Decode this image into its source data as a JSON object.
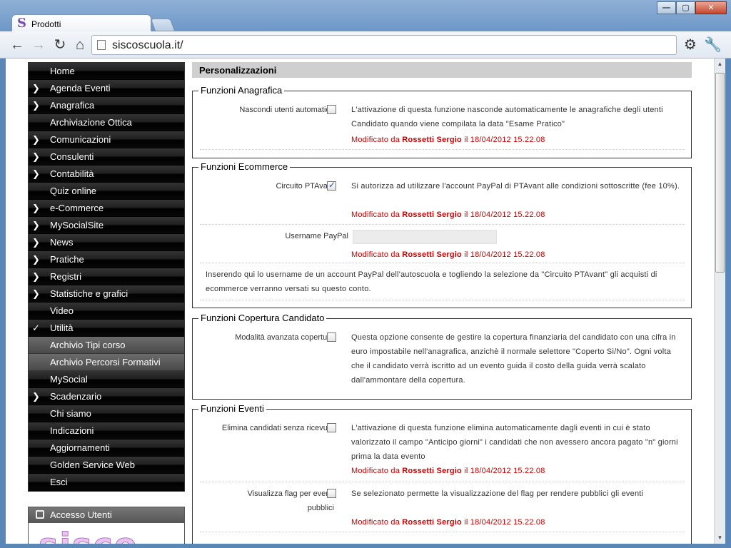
{
  "browser": {
    "tab_title": "Prodotti",
    "url": "siscoscuola.it/",
    "win_minimize": "—",
    "win_maximize": "▢",
    "win_close": "✕"
  },
  "menu": {
    "items": [
      {
        "label": "Home",
        "arrow": ""
      },
      {
        "label": "Agenda Eventi",
        "arrow": "❯"
      },
      {
        "label": "Anagrafica",
        "arrow": "❯"
      },
      {
        "label": "Archiviazione Ottica",
        "arrow": ""
      },
      {
        "label": "Comunicazioni",
        "arrow": "❯"
      },
      {
        "label": "Consulenti",
        "arrow": "❯"
      },
      {
        "label": "Contabilità",
        "arrow": "❯"
      },
      {
        "label": "Quiz online",
        "arrow": ""
      },
      {
        "label": "e-Commerce",
        "arrow": "❯"
      },
      {
        "label": "MySocialSite",
        "arrow": "❯"
      },
      {
        "label": "News",
        "arrow": "❯"
      },
      {
        "label": "Pratiche",
        "arrow": "❯"
      },
      {
        "label": "Registri",
        "arrow": "❯"
      },
      {
        "label": "Statistiche e grafici",
        "arrow": "❯"
      },
      {
        "label": "Video",
        "arrow": ""
      },
      {
        "label": "Utilità",
        "arrow": "✓"
      },
      {
        "label": "Archivio Tipi corso",
        "arrow": ""
      },
      {
        "label": "Archivio Percorsi Formativi",
        "arrow": ""
      },
      {
        "label": "MySocial",
        "arrow": ""
      },
      {
        "label": "Scadenzario",
        "arrow": "❯"
      },
      {
        "label": "Chi siamo",
        "arrow": ""
      },
      {
        "label": "Indicazioni",
        "arrow": ""
      },
      {
        "label": "Aggiornamenti",
        "arrow": ""
      },
      {
        "label": "Golden Service Web",
        "arrow": ""
      },
      {
        "label": "Esci",
        "arrow": ""
      }
    ]
  },
  "access": {
    "title": "Accesso Utenti",
    "logo_text": "sisco"
  },
  "content": {
    "title": "Personalizzazioni",
    "mod_prefix": "Modificato da",
    "mod_user": "Rossetti Sergio",
    "mod_date": "il 18/04/2012 15.22.08",
    "anagrafica": {
      "legend": "Funzioni Anagrafica",
      "label": "Nascondi utenti automatico",
      "desc": "L'attivazione di questa funzione nasconde automaticamente le anagrafiche degli utenti Candidato quando viene compilata la data \"Esame Pratico\""
    },
    "ecommerce": {
      "legend": "Funzioni Ecommerce",
      "paypal_label": "Circuito PTAvant",
      "paypal_desc": "Si autorizza ad utilizzare l'account PayPal di PTAvant alle condizioni sottoscritte (fee 10%).",
      "username_label": "Username PayPal",
      "username_value": "",
      "note": "Inserendo qui lo username de un account PayPal dell'autoscuola e togliendo la selezione da \"Circuito PTAvant\" gli acquisti di ecommerce verranno versati su questo conto."
    },
    "copertura": {
      "legend": "Funzioni Copertura Candidato",
      "label": "Modalità avanzata copertura",
      "desc": "Questa opzione consente de gestire la copertura finanziaria del candidato con una cifra in euro impostabile nell'anagrafica, anzichè il normale selettore \"Coperto Si/No\". Ogni volta che il candidato verrà iscritto ad un evento guida il costo della guida verrà scalato dall'ammontare della copertura."
    },
    "eventi": {
      "legend": "Funzioni Eventi",
      "elimina_label": "Elimina candidati senza ricevuta",
      "elimina_desc": "L'attivazione di questa funzione elimina automaticamente dagli eventi in cui è stato valorizzato il campo \"Anticipo giorni\" i candidati che non avessero ancora pagato \"n\" giorni prima la data evento",
      "flag_label": "Visualizza flag per eventi pubblici",
      "flag_desc": "Se selezionato permette la visualizzazione del flag per rendere pubblici gli eventi"
    }
  }
}
